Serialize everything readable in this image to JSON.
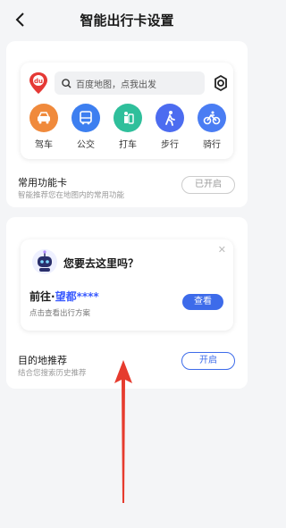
{
  "header": {
    "title": "智能出行卡设置"
  },
  "preview": {
    "search_placeholder": "百度地图，点我出发",
    "modes": [
      {
        "label": "驾车",
        "icon": "car-icon",
        "color": "#f08a3c"
      },
      {
        "label": "公交",
        "icon": "bus-icon",
        "color": "#3d7ff0"
      },
      {
        "label": "打车",
        "icon": "taxi-icon",
        "color": "#2fbf9b"
      },
      {
        "label": "步行",
        "icon": "walk-icon",
        "color": "#4c6cf0"
      },
      {
        "label": "骑行",
        "icon": "bike-icon",
        "color": "#4a7df3"
      }
    ]
  },
  "common_card": {
    "title": "常用功能卡",
    "subtitle": "智能推荐您在地图内的常用功能",
    "button": "已开启"
  },
  "dest_card": {
    "question": "您要去这里吗？",
    "dest_prefix": "前往·",
    "dest_name": "望都****",
    "dest_sub": "点击查看出行方案",
    "view_button": "查看",
    "title": "目的地推荐",
    "subtitle": "结合您搜索历史推荐",
    "button": "开启"
  },
  "colors": {
    "accent": "#3d6bea",
    "arrow": "#e63b2e"
  }
}
